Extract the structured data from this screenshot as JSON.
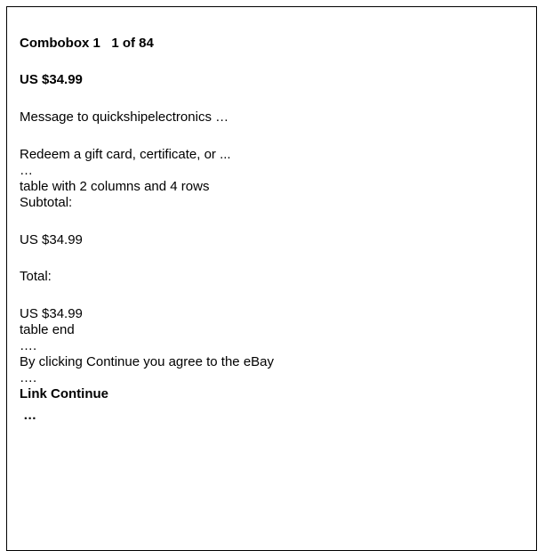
{
  "screen_reader_output": {
    "combobox_line": "Combobox 1   1 of 84",
    "price_heading": "US $34.99",
    "message_to_seller": "Message to quickshipelectronics …",
    "redeem_gift_card": "Redeem a gift card, certificate, or ...",
    "ellipsis_1": "…",
    "table_start": "table with 2 columns and 4 rows",
    "subtotal_label": "Subtotal:",
    "subtotal_value": "US $34.99",
    "total_label": "Total:",
    "total_value": "US $34.99",
    "table_end": "table end",
    "ellipsis_2": "….",
    "agreement_text": "By clicking Continue you agree to the eBay",
    "ellipsis_3": "….",
    "link_continue": "Link Continue",
    "ellipsis_4": " …"
  }
}
